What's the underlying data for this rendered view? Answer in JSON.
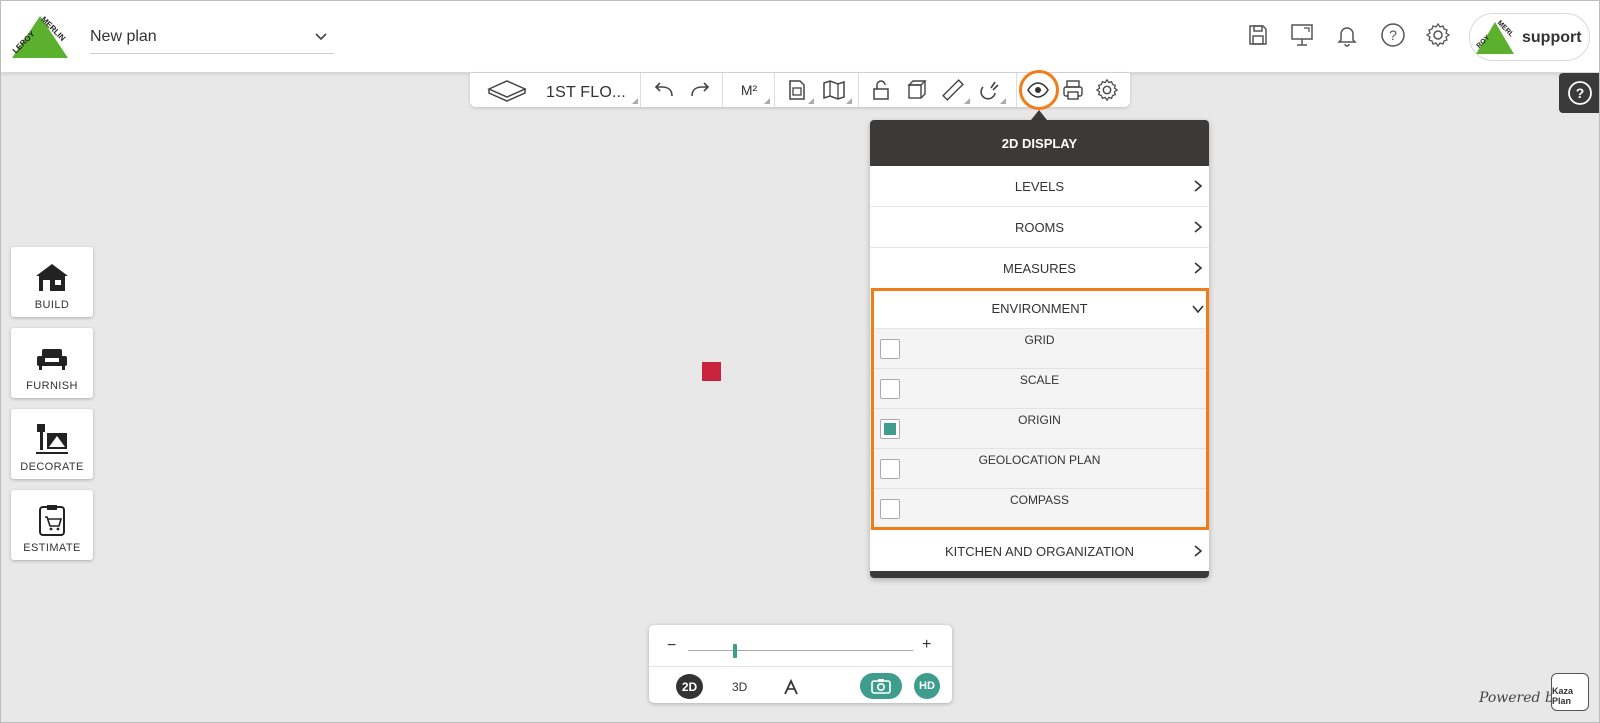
{
  "header": {
    "brand_text": "LEROY MERLIN",
    "plan_name": "New plan",
    "icons": [
      "save-icon",
      "presentation-icon",
      "bell-icon",
      "help-icon",
      "gear-icon"
    ],
    "account_name": "support"
  },
  "toolbar": {
    "floor_label": "1ST FLO...",
    "units_label": "M²",
    "icons": [
      "floor-icon",
      "undo-icon",
      "redo-icon",
      "units-icon",
      "document-icon",
      "map-icon",
      "unlock-icon",
      "cube-icon",
      "ruler-icon",
      "magnet-icon",
      "eye-icon",
      "print-icon",
      "gear-icon"
    ],
    "highlight_color": "#f07d17"
  },
  "left_tools": [
    {
      "label": "BUILD",
      "icon": "house-icon"
    },
    {
      "label": "FURNISH",
      "icon": "sofa-icon"
    },
    {
      "label": "DECORATE",
      "icon": "paint-icon"
    },
    {
      "label": "ESTIMATE",
      "icon": "cart-icon"
    }
  ],
  "display_panel": {
    "title": "2D DISPLAY",
    "rows": {
      "levels": "LEVELS",
      "rooms": "ROOMS",
      "measures": "MEASURES",
      "environment": "ENVIRONMENT",
      "kitchen": "KITCHEN AND ORGANIZATION"
    },
    "environment_items": [
      {
        "label": "GRID",
        "checked": false
      },
      {
        "label": "SCALE",
        "checked": false
      },
      {
        "label": "ORIGIN",
        "checked": true
      },
      {
        "label": "GEOLOCATION PLAN",
        "checked": false
      },
      {
        "label": "COMPASS",
        "checked": false
      }
    ]
  },
  "zoom": {
    "minus": "−",
    "plus": "+",
    "level": 0.21,
    "mode_2d": "2D",
    "mode_3d": "3D",
    "hd": "HD"
  },
  "footer": {
    "powered_by": "Powered by",
    "brand": "Kaza Plan"
  },
  "colors": {
    "accent_green": "#3e9d8c",
    "brand_green": "#5bb02e",
    "origin_marker": "#c8223c",
    "panel_dark": "#3b3a39"
  }
}
